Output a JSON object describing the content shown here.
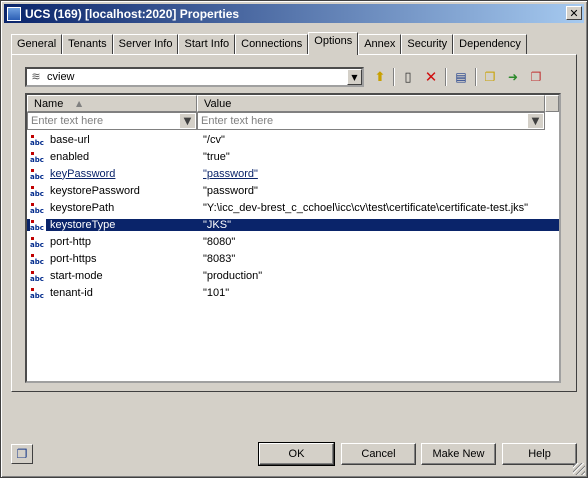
{
  "window": {
    "title": "UCS (169) [localhost:2020] Properties",
    "close_glyph": "✕"
  },
  "tabs": [
    {
      "label": "General"
    },
    {
      "label": "Tenants"
    },
    {
      "label": "Server Info"
    },
    {
      "label": "Start Info"
    },
    {
      "label": "Connections"
    },
    {
      "label": "Options"
    },
    {
      "label": "Annex"
    },
    {
      "label": "Security"
    },
    {
      "label": "Dependency"
    }
  ],
  "active_tab": "Options",
  "toolbar": {
    "combo_value": "cview",
    "buttons": [
      "folder-up-icon",
      "new-document-icon",
      "delete-icon",
      "edit-properties-icon",
      "copy-icon",
      "paste-icon",
      "paste-special-icon"
    ]
  },
  "grid": {
    "columns": {
      "name": "Name",
      "value": "Value"
    },
    "filter_placeholder": "Enter text here",
    "rows": [
      {
        "name": "base-url",
        "value": "\"/cv\""
      },
      {
        "name": "enabled",
        "value": "\"true\""
      },
      {
        "name": "keyPassword",
        "value": "\"password\""
      },
      {
        "name": "keystorePassword",
        "value": "\"password\""
      },
      {
        "name": "keystorePath",
        "value": "\"Y:\\icc_dev-brest_c_cchoel\\icc\\cv\\test\\certificate\\certificate-test.jks\""
      },
      {
        "name": "keystoreType",
        "value": "\"JKS\""
      },
      {
        "name": "port-http",
        "value": "\"8080\""
      },
      {
        "name": "port-https",
        "value": "\"8083\""
      },
      {
        "name": "start-mode",
        "value": "\"production\""
      },
      {
        "name": "tenant-id",
        "value": "\"101\""
      }
    ],
    "selected_row": "keystoreType",
    "linked_row": "keyPassword"
  },
  "buttons": {
    "ok": "OK",
    "cancel": "Cancel",
    "make_new": "Make New",
    "help": "Help"
  },
  "colors": {
    "title_start": "#0a246a",
    "title_end": "#a6caf0",
    "selection": "#0a246a",
    "face": "#d4d0c8"
  }
}
